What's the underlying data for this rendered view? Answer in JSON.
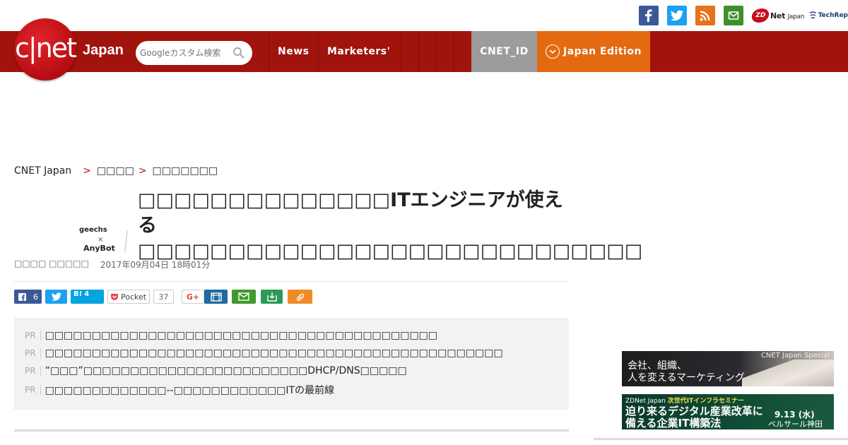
{
  "header": {
    "logo_text": "c|net",
    "logo_suffix": "Japan",
    "search_placeholder": "Googleカスタム検索",
    "zdnet_badge": "ZD",
    "zdnet_text": "Net",
    "zdnet_suffix": "Japan",
    "techrepublic_text": "TechRep"
  },
  "nav": {
    "items": [
      "News",
      "Marketers'"
    ],
    "cnet_id": "CNET_ID",
    "edition": "Japan Edition"
  },
  "breadcrumb": [
    "CNET Japan",
    "□□□□",
    "□□□□□□□"
  ],
  "breadcrumb_sep": ">",
  "article": {
    "thumb_line1": "geechs",
    "thumb_line2": "×",
    "thumb_line3": "AnyBot",
    "title": "□□□□□□□□□□□□□□ITエンジニアが使える□□□□□□□□□□□□□□□□□□□□□□□□□□□□",
    "author": "□□□□ □□□□□",
    "date": "2017年09月04日 18時01分"
  },
  "share": {
    "fb_count": "6",
    "hatena_label": "B!",
    "hatena_count": "4",
    "pocket_label": "Pocket",
    "pocket_count": "37",
    "gplus_label": "G+"
  },
  "pr": {
    "label": "PR",
    "items": [
      "□□□□□□□□□□□□□□□□□□□□□□□□□□□□□□□□□□□□□□□□□□",
      "□□□□□□□□□□□□□□□□□□□□□□□□□□□□□□□□□□□□□□□□□□□□□□□□□",
      "“□□□”□□□□□□□□□□□□□□□□□□□□□□□□DHCP/DNS□□□□□",
      "□□□□□□□□□□□□□--□□□□□□□□□□□□ITの最前線"
    ]
  },
  "ads": {
    "ad1_special": "CNET Japan Special",
    "ad1_line1": "会社、組織、",
    "ad1_line2": "人を変えるマーケティング",
    "ad2_brand": "ZDNet Japan",
    "ad2_tag": "次世代ITインフラセミナー",
    "ad2_line1": "迫り来るデジタル産業改革に",
    "ad2_line2": "備える企業IT構築法",
    "ad2_date": "9.13 (水)",
    "ad2_venue": "ベルサール神田"
  }
}
